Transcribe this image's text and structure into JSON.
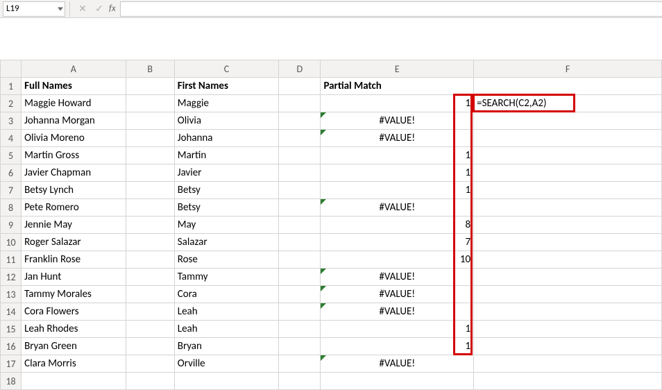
{
  "formula_bar": {
    "name_box": "L19",
    "cancel_glyph": "✕",
    "enter_glyph": "✓",
    "fx_label": "fx",
    "formula_value": ""
  },
  "columns": [
    "A",
    "B",
    "C",
    "D",
    "E",
    "F"
  ],
  "row_numbers": [
    "1",
    "2",
    "3",
    "4",
    "5",
    "6",
    "7",
    "8",
    "9",
    "10",
    "11",
    "12",
    "13",
    "14",
    "15",
    "16",
    "17",
    "18"
  ],
  "headers": {
    "A": "Full Names",
    "C": "First Names",
    "E": "Partial Match"
  },
  "rows": [
    {
      "A": "Maggie Howard",
      "C": "Maggie",
      "E": "1",
      "F": "=SEARCH(C2,A2)",
      "err": false,
      "align": "right"
    },
    {
      "A": "Johanna Morgan",
      "C": "Olivia",
      "E": "#VALUE!",
      "F": "",
      "err": true,
      "align": "center"
    },
    {
      "A": "Olivia Moreno",
      "C": "Johanna",
      "E": "#VALUE!",
      "F": "",
      "err": true,
      "align": "center"
    },
    {
      "A": "Martin Gross",
      "C": "Martin",
      "E": "1",
      "F": "",
      "err": false,
      "align": "right"
    },
    {
      "A": "Javier Chapman",
      "C": "Javier",
      "E": "1",
      "F": "",
      "err": false,
      "align": "right"
    },
    {
      "A": "Betsy Lynch",
      "C": "Betsy",
      "E": "1",
      "F": "",
      "err": false,
      "align": "right"
    },
    {
      "A": "Pete Romero",
      "C": "Betsy",
      "E": "#VALUE!",
      "F": "",
      "err": true,
      "align": "center"
    },
    {
      "A": "Jennie May",
      "C": "May",
      "E": "8",
      "F": "",
      "err": false,
      "align": "right"
    },
    {
      "A": "Roger Salazar",
      "C": "Salazar",
      "E": "7",
      "F": "",
      "err": false,
      "align": "right"
    },
    {
      "A": "Franklin Rose",
      "C": "Rose",
      "E": "10",
      "F": "",
      "err": false,
      "align": "right"
    },
    {
      "A": "Jan Hunt",
      "C": "Tammy",
      "E": "#VALUE!",
      "F": "",
      "err": true,
      "align": "center"
    },
    {
      "A": "Tammy Morales",
      "C": "Cora",
      "E": "#VALUE!",
      "F": "",
      "err": true,
      "align": "center"
    },
    {
      "A": "Cora Flowers",
      "C": "Leah",
      "E": "#VALUE!",
      "F": "",
      "err": true,
      "align": "center"
    },
    {
      "A": "Leah Rhodes",
      "C": "Leah",
      "E": "1",
      "F": "",
      "err": false,
      "align": "right"
    },
    {
      "A": "Bryan Green",
      "C": "Bryan",
      "E": "1",
      "F": "",
      "err": false,
      "align": "right"
    },
    {
      "A": "Clara Morris",
      "C": "Orville",
      "E": "#VALUE!",
      "F": "",
      "err": true,
      "align": "center"
    }
  ],
  "annotation": {
    "col_box": {
      "target": "E2:E16"
    },
    "formula_box": {
      "target": "F2"
    }
  }
}
